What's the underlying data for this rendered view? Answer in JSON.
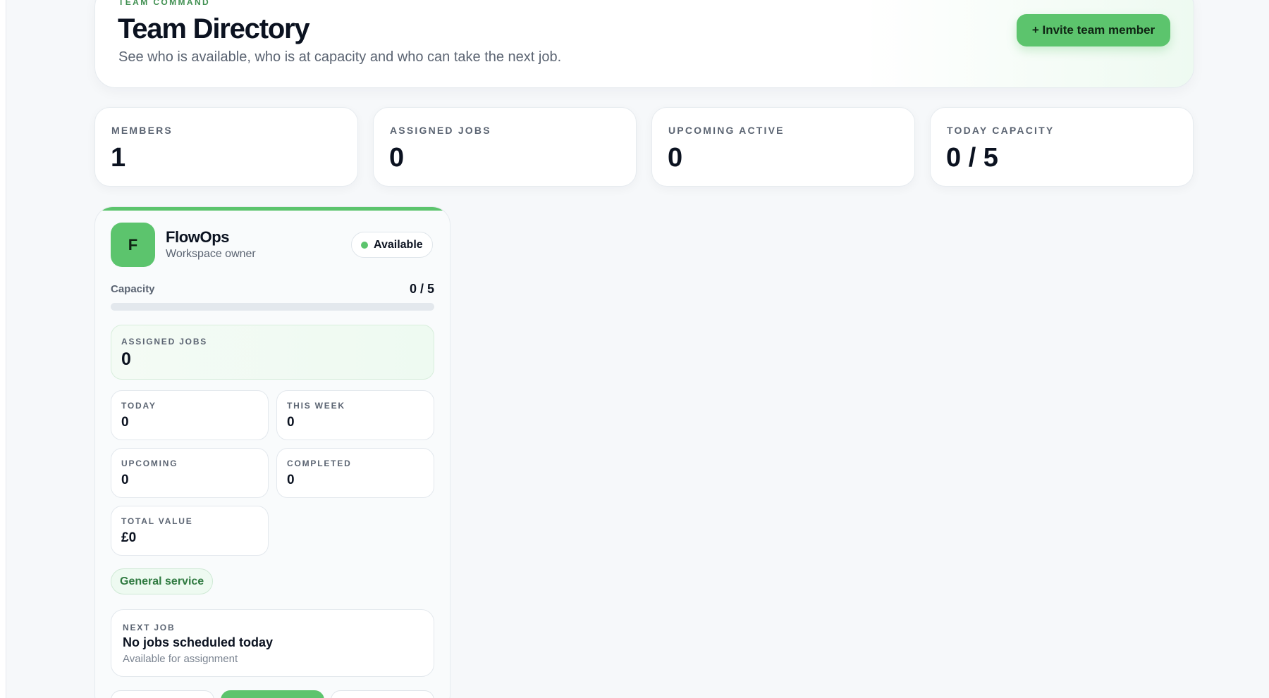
{
  "header": {
    "eyebrow": "TEAM COMMAND",
    "title": "Team Directory",
    "subtitle": "See who is available, who is at capacity and who can take the next job.",
    "invite_label": "+ Invite team member"
  },
  "stats": [
    {
      "label": "MEMBERS",
      "value": "1"
    },
    {
      "label": "ASSIGNED JOBS",
      "value": "0"
    },
    {
      "label": "UPCOMING ACTIVE",
      "value": "0"
    },
    {
      "label": "TODAY CAPACITY",
      "value": "0 / 5"
    }
  ],
  "member": {
    "initial": "F",
    "name": "FlowOps",
    "role": "Workspace owner",
    "status": "Available",
    "capacity_label": "Capacity",
    "capacity_value": "0 / 5",
    "capacity_fraction": 0,
    "assigned": {
      "label": "ASSIGNED JOBS",
      "value": "0"
    },
    "today": {
      "label": "TODAY",
      "value": "0"
    },
    "this_week": {
      "label": "THIS WEEK",
      "value": "0"
    },
    "upcoming": {
      "label": "UPCOMING",
      "value": "0"
    },
    "completed": {
      "label": "COMPLETED",
      "value": "0"
    },
    "total_value": {
      "label": "TOTAL VALUE",
      "value": "£0"
    },
    "service_tag": "General service",
    "next_job": {
      "label": "NEXT JOB",
      "title": "No jobs scheduled today",
      "subtitle": "Available for assignment"
    }
  },
  "colors": {
    "accent": "#5cc46d",
    "eyebrow": "#3f8f50",
    "text": "#0b1220",
    "muted": "#5b6472"
  }
}
